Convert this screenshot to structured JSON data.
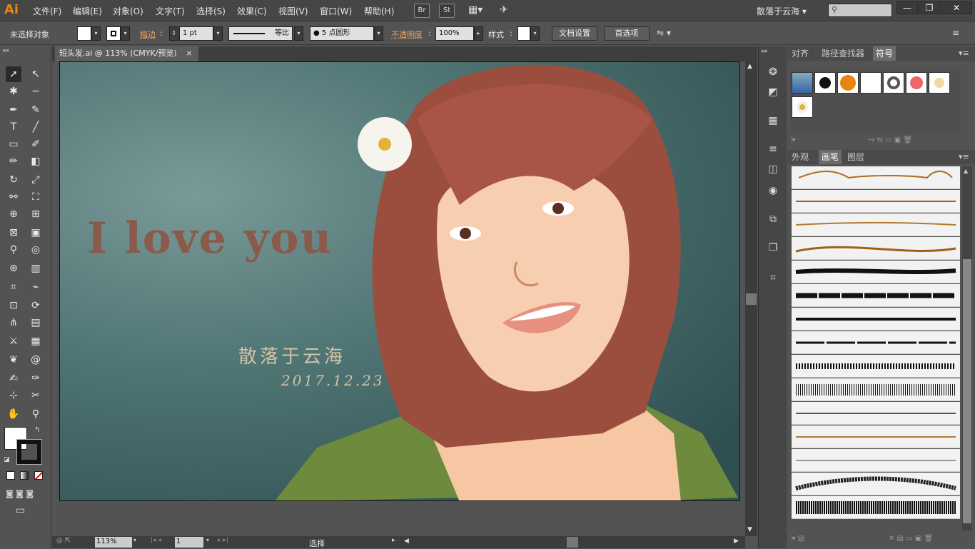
{
  "app": {
    "logo": "Ai"
  },
  "menu": [
    "文件(F)",
    "编辑(E)",
    "对象(O)",
    "文字(T)",
    "选择(S)",
    "效果(C)",
    "视图(V)",
    "窗口(W)",
    "帮助(H)"
  ],
  "bridge_buttons": [
    "Br",
    "St"
  ],
  "workspace": "散落于云海",
  "window_controls": [
    "—",
    "❐",
    "✕"
  ],
  "control_bar": {
    "selection_status": "未选择对象",
    "stroke_label": "描边",
    "stroke_weight": "1 pt",
    "profile": "等比",
    "brush": "5 点圆形",
    "opacity_label": "不透明度",
    "opacity_value": "100%",
    "style_label": "样式",
    "doc_setup": "文档设置",
    "prefs": "首选项"
  },
  "document": {
    "tab_title": "短头发.ai @ 113% (CMYK/预览)",
    "close": "×"
  },
  "artwork": {
    "headline": "I love you",
    "signature": "散落于云海",
    "date": "2017.12.23"
  },
  "status_bar": {
    "zoom": "113%",
    "artboard": "1",
    "tool": "选择"
  },
  "panel_top": {
    "tabs": [
      "对齐",
      "路径查找器",
      "符号"
    ],
    "active": 2
  },
  "panel_bottom": {
    "tabs": [
      "外观",
      "画笔",
      "图层"
    ],
    "active": 1
  },
  "colors": {
    "accent": "#e8850f",
    "hair": "#a0503f",
    "bg": "#4f7574",
    "text_art": "#8a5a4a"
  }
}
